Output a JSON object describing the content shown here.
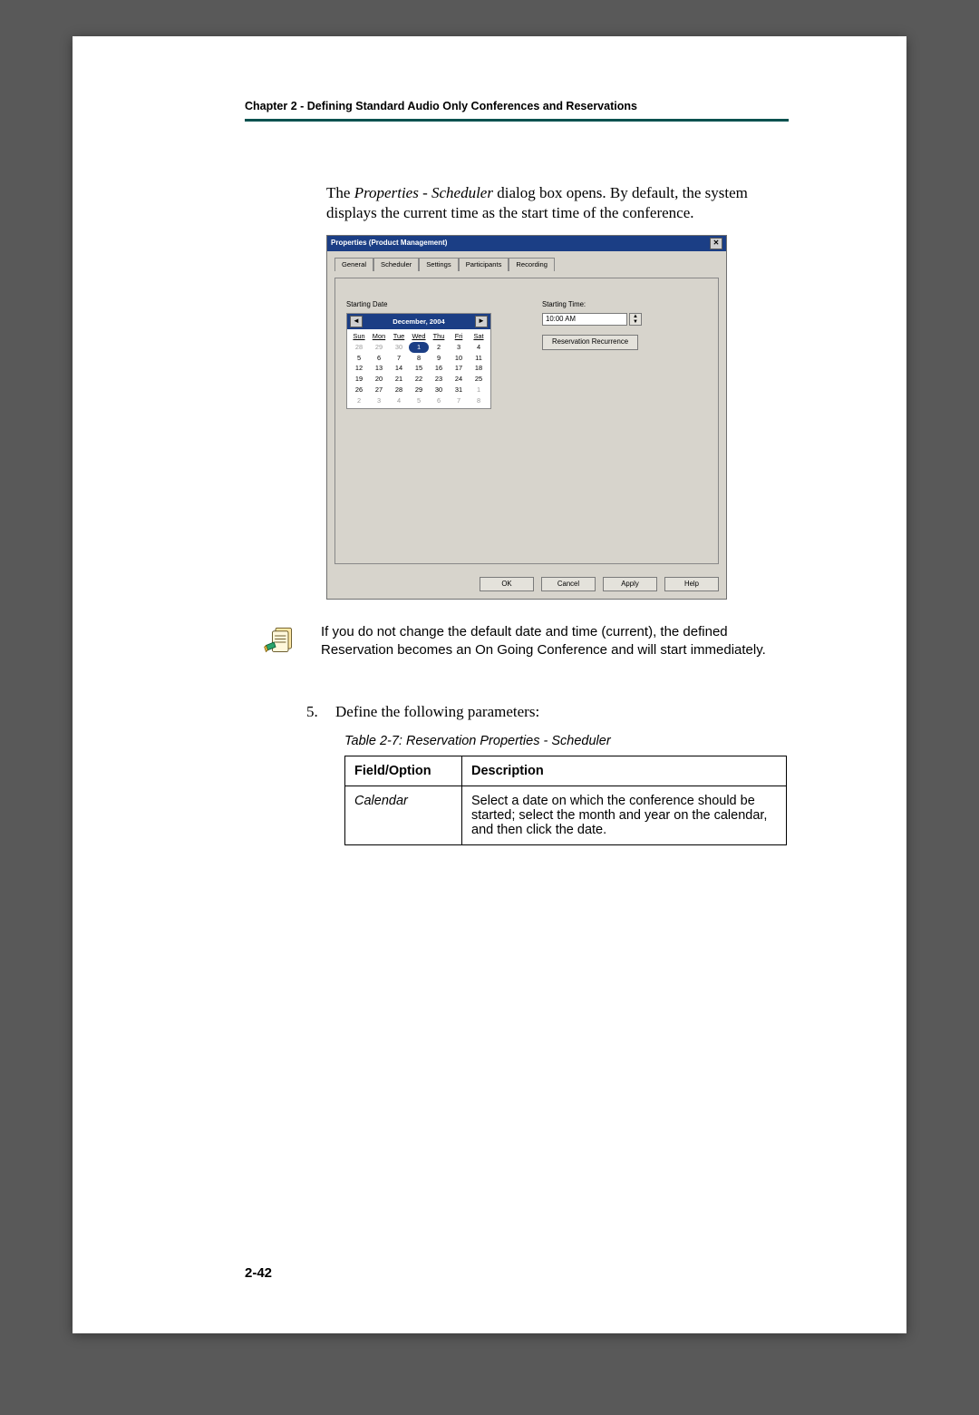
{
  "runningHead": "Chapter 2 - Defining Standard Audio Only Conferences and Reservations",
  "intro_pre": "The ",
  "intro_dialog_name": "Properties - Scheduler",
  "intro_post": " dialog box opens. By default, the system displays the current time as the start time of the conference.",
  "dialog": {
    "title": "Properties  (Product Management)",
    "close_glyph": "✕",
    "tabs": [
      "General",
      "Scheduler",
      "Settings",
      "Participants",
      "Recording"
    ],
    "startingDateLabel": "Starting Date",
    "calendar": {
      "prev": "◄",
      "next": "►",
      "monthTitle": "December, 2004",
      "dow": [
        "Sun",
        "Mon",
        "Tue",
        "Wed",
        "Thu",
        "Fri",
        "Sat"
      ],
      "days": [
        {
          "n": "28",
          "muted": true
        },
        {
          "n": "29",
          "muted": true
        },
        {
          "n": "30",
          "muted": true
        },
        {
          "n": "1",
          "today": true
        },
        {
          "n": "2"
        },
        {
          "n": "3"
        },
        {
          "n": "4"
        },
        {
          "n": "5"
        },
        {
          "n": "6"
        },
        {
          "n": "7"
        },
        {
          "n": "8"
        },
        {
          "n": "9"
        },
        {
          "n": "10"
        },
        {
          "n": "11"
        },
        {
          "n": "12"
        },
        {
          "n": "13"
        },
        {
          "n": "14"
        },
        {
          "n": "15"
        },
        {
          "n": "16"
        },
        {
          "n": "17"
        },
        {
          "n": "18"
        },
        {
          "n": "19"
        },
        {
          "n": "20"
        },
        {
          "n": "21"
        },
        {
          "n": "22"
        },
        {
          "n": "23"
        },
        {
          "n": "24"
        },
        {
          "n": "25"
        },
        {
          "n": "26"
        },
        {
          "n": "27"
        },
        {
          "n": "28"
        },
        {
          "n": "29"
        },
        {
          "n": "30"
        },
        {
          "n": "31"
        },
        {
          "n": "1",
          "muted": true
        },
        {
          "n": "2",
          "muted": true
        },
        {
          "n": "3",
          "muted": true
        },
        {
          "n": "4",
          "muted": true
        },
        {
          "n": "5",
          "muted": true
        },
        {
          "n": "6",
          "muted": true
        },
        {
          "n": "7",
          "muted": true
        },
        {
          "n": "8",
          "muted": true
        }
      ]
    },
    "startingTimeLabel": "Starting Time:",
    "startingTimeValue": "10:00 AM",
    "recurrenceBtn": "Reservation Recurrence",
    "buttons": {
      "ok": "OK",
      "cancel": "Cancel",
      "apply": "Apply",
      "help": "Help"
    }
  },
  "note": "If you do not change the default date and time (current), the defined Reservation becomes an On Going Conference and will start immediately.",
  "step_num": "5.",
  "step_text": "Define the following parameters:",
  "tableCaption": "Table 2-7: Reservation Properties - Scheduler",
  "table": {
    "h1": "Field/Option",
    "h2": "Description",
    "rows": [
      {
        "field": "Calendar",
        "desc": "Select a date on which the conference should be started; select the month and year on the calendar, and then click the date."
      }
    ]
  },
  "pageNumber": "2-42"
}
